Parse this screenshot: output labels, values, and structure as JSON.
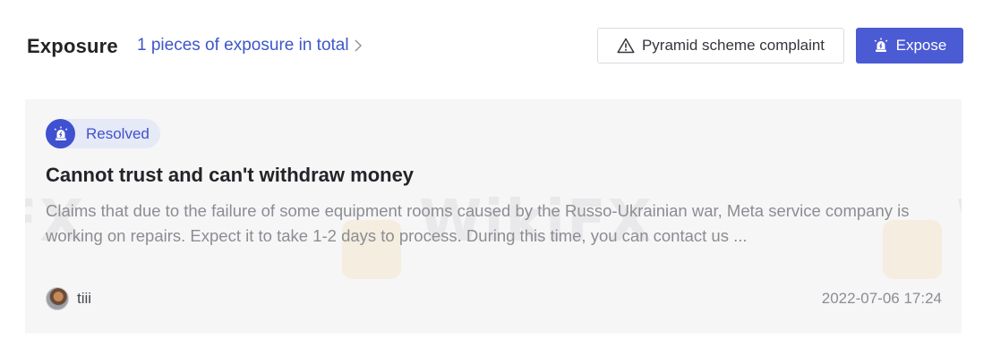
{
  "header": {
    "title": "Exposure",
    "count_text": "1 pieces of exposure in total",
    "complaint_button": "Pyramid scheme complaint",
    "expose_button": "Expose"
  },
  "card": {
    "status": "Resolved",
    "title": "Cannot trust and can't withdraw money",
    "description": "Claims that due to the failure of some equipment rooms caused by the Russo-Ukrainian war, Meta service company is working on repairs. Expect it to take 1-2 days to process. During this time, you can contact us ...",
    "author": "tiii",
    "date": "2022-07-06 17:24"
  },
  "watermark": {
    "left_text": "FX",
    "center_text": "WikiFX",
    "right_text": "W"
  },
  "colors": {
    "accent": "#4a5bd3",
    "link": "#3d56c9",
    "card_bg": "#f6f6f7",
    "badge_bg": "#e6e9f6"
  },
  "icons": {
    "complaint": "warning-triangle-icon",
    "expose": "alarm-siren-icon",
    "status": "alarm-siren-icon",
    "count_link": "chevron-right-icon"
  }
}
